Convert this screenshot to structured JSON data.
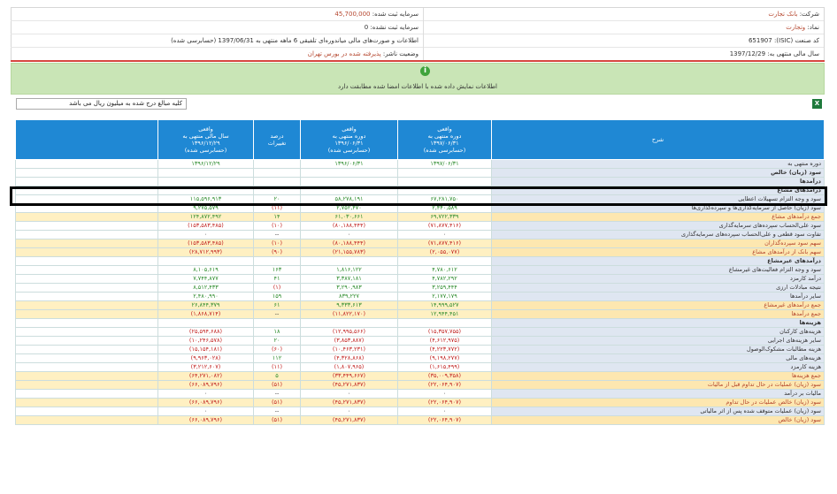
{
  "header": {
    "right": [
      {
        "label": "شرکت:",
        "value": "بانک تجارت",
        "style": "red"
      },
      {
        "label": "نماد:",
        "value": "وتجارت",
        "style": "red"
      },
      {
        "label": "کد صنعت (ISIC):",
        "value": "651907",
        "style": "plain"
      },
      {
        "label": "سال مالی منتهی به:",
        "value": "1397/12/29",
        "style": "plain"
      }
    ],
    "left": [
      {
        "label": "سرمایه ثبت شده:",
        "value": "45,700,000",
        "style": "red"
      },
      {
        "label": "سرمایه ثبت نشده:",
        "value": "0",
        "style": "plain"
      },
      {
        "label": "اطلاعات و صورت‌های مالی میاندوره‌ای تلفیقی 6 ماهه منتهی به 1397/06/31 (حسابرسی شده)",
        "value": "",
        "style": "plain"
      },
      {
        "label": "وضعیت ناشر:",
        "value": "پذیرفته شده در بورس تهران",
        "style": "red"
      }
    ]
  },
  "banner": {
    "icon": "i",
    "text": "اطلاعات نمایش داده شده با اطلاعات امضا شده مطابقت دارد"
  },
  "units_select": "کلیه مبالغ درج شده به میلیون ریال می باشد",
  "excel_icon": "X",
  "table": {
    "headers": {
      "desc": "شرح",
      "c1": [
        "واقعی",
        "دوره منتهی به",
        "۱۳۹۷/۰۶/۳۱",
        "(حسابرسی شده)"
      ],
      "c2": [
        "واقعی",
        "دوره منتهی به",
        "۱۳۹۶/۰۶/۳۱",
        "(حسابرسی شده)"
      ],
      "c3": [
        "درصد",
        "تغییرات"
      ],
      "c4": [
        "واقعی",
        "سال مالی منتهی به",
        "۱۳۹۶/۱۲/۲۹",
        "(حسابرسی شده)"
      ]
    },
    "rows": [
      {
        "desc": "دوره منتهی به",
        "c1": "۱۳۹۷/۰۶/۳۱",
        "c2": "۱۳۹۶/۰۶/۳۱",
        "c3": "",
        "c4": "۱۳۹۶/۱۲/۲۹",
        "kind": "date"
      },
      {
        "desc": "سود (زیان) خالص",
        "c1": "",
        "c2": "",
        "c3": "",
        "c4": "",
        "kind": "section"
      },
      {
        "desc": "درآمدها",
        "c1": "",
        "c2": "",
        "c3": "",
        "c4": "",
        "kind": "section"
      },
      {
        "desc": "درآمدهای مشاع",
        "c1": "",
        "c2": "",
        "c3": "",
        "c4": "",
        "kind": "section"
      },
      {
        "desc": "سود و وجه التزام تسهیلات اعطایی",
        "c1": "۶۷,۲۸۱,۷۵۰",
        "c2": "۵۸,۲۷۸,۱۹۱",
        "c3": "۲۰",
        "c4": "۱۱۵,۵۹۶,۹۱۳",
        "kind": "normal"
      },
      {
        "desc": "سود (زیان) حاصل از سرمایه‌گذاری‌ها و سپرده‌گذاری‌ها",
        "c1": "۲,۴۴۰,۵۸۹",
        "c2": "۲,۷۵۲,۴۷۰",
        "c3": "(۱۱)",
        "c4": "۹,۲۷۵,۵۷۹",
        "kind": "normal"
      },
      {
        "desc": "جمع درآمدهای مشاع",
        "c1": "۶۹,۷۲۲,۳۳۹",
        "c2": "۶۱,۰۳۰,۶۶۱",
        "c3": "۱۴",
        "c4": "۱۲۴,۸۷۲,۴۹۲",
        "kind": "total"
      },
      {
        "desc": "سود علی‌الحساب سپرده‌های سرمایه‌گذاری",
        "c1": "(۷۱,۸۷۷,۴۱۶)",
        "c2": "(۸۰,۱۸۸,۴۴۴)",
        "c3": "(۱۰)",
        "c4": "(۱۵۳,۵۸۳,۴۸۵)",
        "kind": "normal"
      },
      {
        "desc": "تفاوت سود قطعی و علی‌الحساب سپرده‌های سرمایه‌گذاری",
        "c1": "۰",
        "c2": "۰",
        "c3": "--",
        "c4": "۰",
        "kind": "normal"
      },
      {
        "desc": "سهم سود سپرده‌گذاران",
        "c1": "(۷۱,۸۷۷,۴۱۶)",
        "c2": "(۸۰,۱۸۸,۴۴۴)",
        "c3": "(۱۰)",
        "c4": "(۱۵۳,۵۸۳,۴۸۵)",
        "kind": "total"
      },
      {
        "desc": "سهم بانک از درآمدهای مشاع",
        "c1": "(۲,۰۵۵,۰۷۷)",
        "c2": "(۲۱,۱۵۵,۷۸۳)",
        "c3": "(۹۰)",
        "c4": "(۲۸,۷۱۲,۹۹۳)",
        "kind": "total"
      },
      {
        "desc": "درآمدهای غیرمشاع",
        "c1": "",
        "c2": "",
        "c3": "",
        "c4": "",
        "kind": "section"
      },
      {
        "desc": "سود و وجه التزام فعالیت‌های غیرمشاع",
        "c1": "۴,۷۸۰,۶۱۲",
        "c2": "۱,۸۱۶,۱۲۲",
        "c3": "۱۶۳",
        "c4": "۸,۱۰۵,۶۱۹",
        "kind": "normal"
      },
      {
        "desc": "درآمد کارمزد",
        "c1": "۴,۷۸۲,۲۹۲",
        "c2": "۳,۳۸۷,۱۸۱",
        "c3": "۴۱",
        "c4": "۷,۷۴۴,۸۷۷",
        "kind": "normal"
      },
      {
        "desc": "نتیجه مبادلات ارزی",
        "c1": "۳,۲۵۹,۴۴۴",
        "c2": "۳,۲۹۰,۹۸۳",
        "c3": "(۱)",
        "c4": "۸,۵۱۲,۴۳۳",
        "kind": "normal"
      },
      {
        "desc": "سایر درآمدها",
        "c1": "۲,۱۷۷,۱۷۹",
        "c2": "۸۳۹,۲۲۷",
        "c3": "۱۵۹",
        "c4": "۲,۴۸۰,۹۹۰",
        "kind": "normal"
      },
      {
        "desc": "جمع درآمدهای غیرمشاع",
        "c1": "۱۴,۹۹۹,۵۲۷",
        "c2": "۹,۳۳۳,۶۱۳",
        "c3": "۶۱",
        "c4": "۲۶,۸۴۴,۳۷۹",
        "kind": "total"
      },
      {
        "desc": "جمع درآمدها",
        "c1": "۱۲,۹۴۴,۴۵۱",
        "c2": "(۱۱,۸۲۲,۱۷۰)",
        "c3": "--",
        "c4": "(۱,۸۶۸,۷۱۴)",
        "kind": "total"
      },
      {
        "desc": "هزینه‌ها",
        "c1": "",
        "c2": "",
        "c3": "",
        "c4": "",
        "kind": "section"
      },
      {
        "desc": "هزینه‌های کارکنان",
        "c1": "(۱۵,۳۵۷,۷۵۵)",
        "c2": "(۱۲,۹۹۵,۵۶۶)",
        "c3": "۱۸",
        "c4": "(۲۵,۵۹۴,۶۸۸)",
        "kind": "normal"
      },
      {
        "desc": "سایر هزینه‌های اجرایی",
        "c1": "(۴,۶۱۲,۹۷۵)",
        "c2": "(۳,۸۵۳,۸۸۷)",
        "c3": "۲۰",
        "c4": "(۱۰,۲۴۶,۵۷۸)",
        "kind": "normal"
      },
      {
        "desc": "هزینه مطالبات مشکوک‌الوصول",
        "c1": "(۴,۲۲۳,۷۷۲)",
        "c2": "(۱۰,۴۶۳,۲۳۱)",
        "c3": "(۶۰)",
        "c4": "(۱۵,۱۵۴,۱۸۱)",
        "kind": "normal"
      },
      {
        "desc": "هزینه‌های مالی",
        "c1": "(۹,۱۹۸,۲۷۷)",
        "c2": "(۴,۳۲۸,۸۶۸)",
        "c3": "۱۱۲",
        "c4": "(۹,۹۶۳,۰۲۸)",
        "kind": "normal"
      },
      {
        "desc": "هزینه کارمزد",
        "c1": "(۱,۶۱۵,۴۹۹)",
        "c2": "(۱,۸۰۷,۹۶۵)",
        "c3": "(۱۱)",
        "c4": "(۳,۲۱۲,۶۰۷)",
        "kind": "normal"
      },
      {
        "desc": "جمع هزینه‌ها",
        "c1": "(۳۵,۰۰۹,۳۵۸)",
        "c2": "(۳۳,۴۴۹,۶۶۷)",
        "c3": "۵",
        "c4": "(۶۴,۲۷۱,۰۸۲)",
        "kind": "total"
      },
      {
        "desc": "سود (زیان) عملیات در حال تداوم قبل از مالیات",
        "c1": "(۲۲,۰۶۴,۹۰۷)",
        "c2": "(۴۵,۲۷۱,۸۳۷)",
        "c3": "(۵۱)",
        "c4": "(۶۶,۰۸۹,۷۹۶)",
        "kind": "total"
      },
      {
        "desc": "مالیات بر درآمد",
        "c1": "۰",
        "c2": "۰",
        "c3": "--",
        "c4": "۰",
        "kind": "normal"
      },
      {
        "desc": "سود (زیان) خالص عملیات در حال تداوم",
        "c1": "(۲۲,۰۶۴,۹۰۷)",
        "c2": "(۴۵,۲۷۱,۸۳۷)",
        "c3": "(۵۱)",
        "c4": "(۶۶,۰۸۹,۷۹۶)",
        "kind": "total"
      },
      {
        "desc": "سود (زیان) عملیات متوقف شده پس از اثر مالیاتی",
        "c1": "۰",
        "c2": "۰",
        "c3": "--",
        "c4": "۰",
        "kind": "normal"
      },
      {
        "desc": "سود (زیان) خالص",
        "c1": "(۲۲,۰۶۴,۹۰۷)",
        "c2": "(۴۵,۲۷۱,۸۳۷)",
        "c3": "(۵۱)",
        "c4": "(۶۶,۰۸۹,۷۹۶)",
        "kind": "total"
      }
    ]
  },
  "colors": {
    "header_blue": "#1f88d4",
    "banner_green": "#c9e5b6",
    "total_row": "#fff0c2",
    "negative": "#c0201e",
    "positive": "#2a8a2a"
  }
}
